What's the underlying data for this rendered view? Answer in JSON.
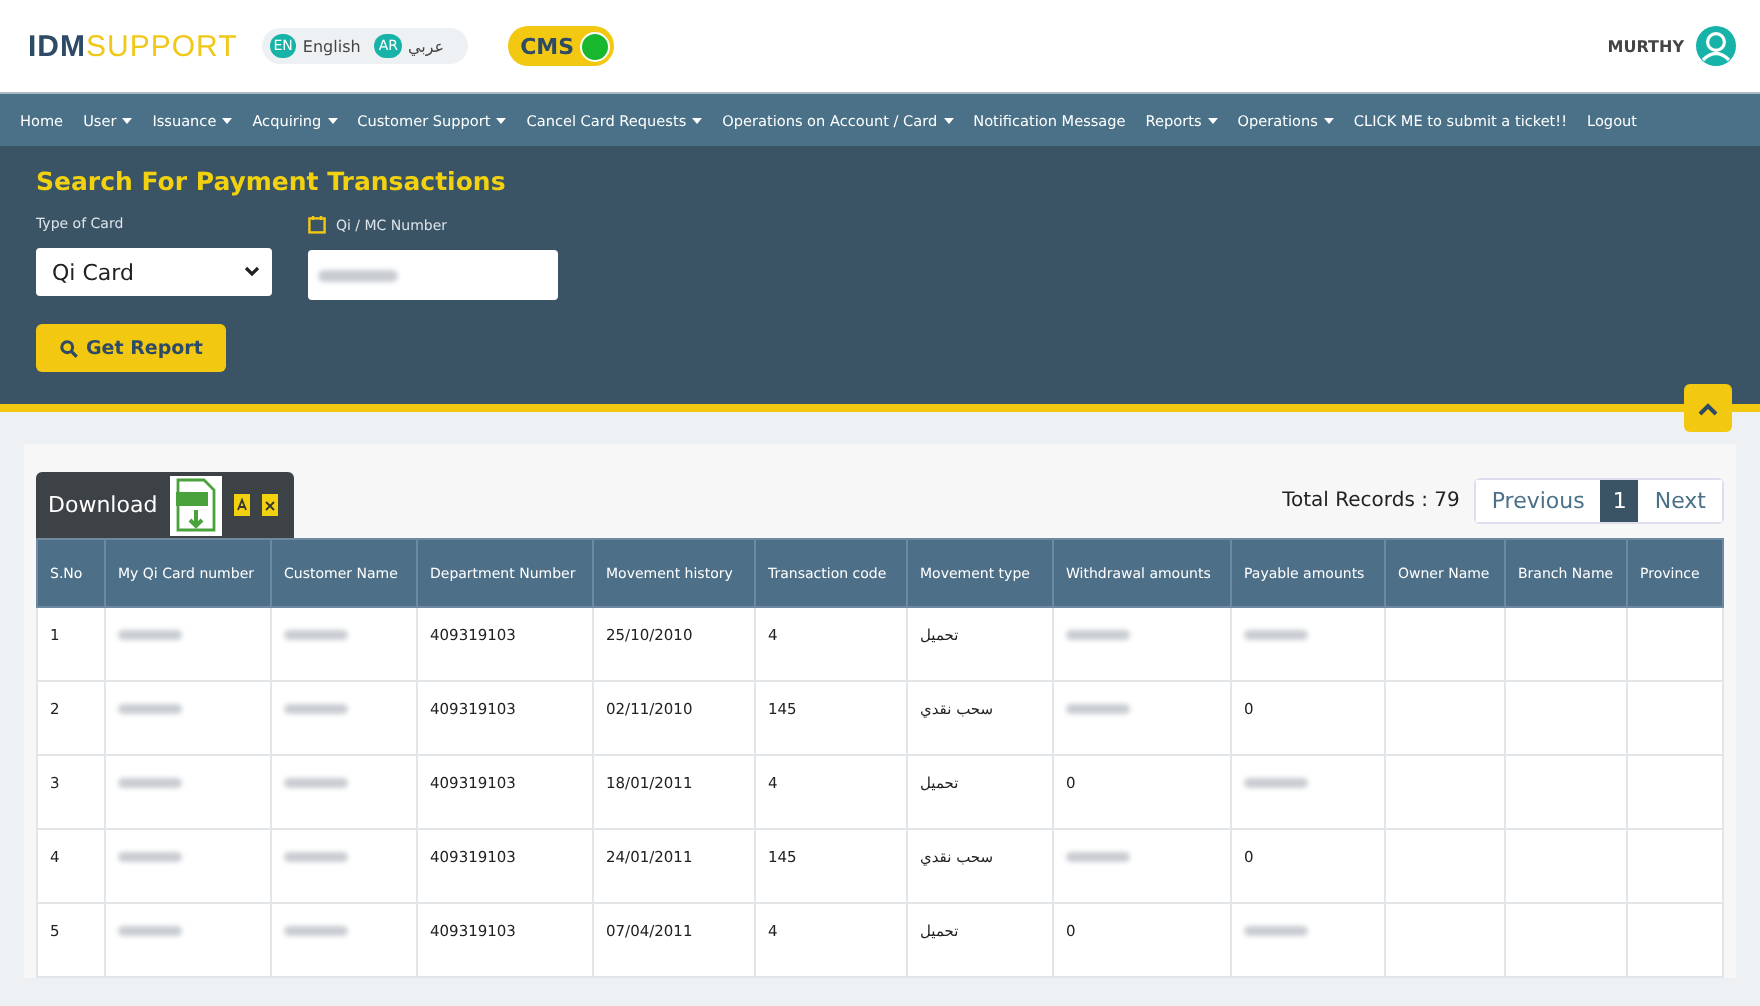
{
  "header": {
    "logo_primary": "IDM",
    "logo_secondary": "SUPPORT",
    "languages": [
      {
        "code": "EN",
        "label": "English"
      },
      {
        "code": "AR",
        "label": "عربي"
      }
    ],
    "cms_toggle": {
      "label": "CMS",
      "on": true
    },
    "user": "MURTHY"
  },
  "nav": [
    {
      "label": "Home",
      "dropdown": false
    },
    {
      "label": "User",
      "dropdown": true
    },
    {
      "label": "Issuance",
      "dropdown": true
    },
    {
      "label": "Acquiring",
      "dropdown": true
    },
    {
      "label": "Customer Support",
      "dropdown": true
    },
    {
      "label": "Cancel Card Requests",
      "dropdown": true
    },
    {
      "label": "Operations on Account / Card",
      "dropdown": true
    },
    {
      "label": "Notification Message",
      "dropdown": false
    },
    {
      "label": "Reports",
      "dropdown": true
    },
    {
      "label": "Operations",
      "dropdown": true
    },
    {
      "label": "CLICK ME to submit a ticket!!",
      "dropdown": false
    },
    {
      "label": "Logout",
      "dropdown": false
    }
  ],
  "search": {
    "title": "Search For Payment Transactions",
    "card_type": {
      "label": "Type of Card",
      "value": "Qi Card"
    },
    "number": {
      "label": "Qi / MC Number",
      "redacted": true
    },
    "button": "Get Report"
  },
  "results": {
    "download_label": "Download",
    "total_label": "Total Records : 79",
    "pagination": [
      {
        "label": "Previous",
        "selected": false
      },
      {
        "label": "1",
        "selected": true
      },
      {
        "label": "Next",
        "selected": false
      }
    ],
    "columns": [
      "S.No",
      "My Qi Card number",
      "Customer Name",
      "Department Number",
      "Movement history",
      "Transaction code",
      "Movement type",
      "Withdrawal amounts",
      "Payable amounts",
      "Owner Name",
      "Branch Name",
      "Province"
    ],
    "rows": [
      {
        "cells": [
          {
            "text": "1"
          },
          {
            "redacted": true
          },
          {
            "redacted": true
          },
          {
            "text": "409319103"
          },
          {
            "text": "25/10/2010"
          },
          {
            "text": "4"
          },
          {
            "text": "تحميل"
          },
          {
            "redacted": true
          },
          {
            "redacted": true
          },
          {},
          {},
          {}
        ]
      },
      {
        "cells": [
          {
            "text": "2"
          },
          {
            "redacted": true
          },
          {
            "redacted": true
          },
          {
            "text": "409319103"
          },
          {
            "text": "02/11/2010"
          },
          {
            "text": "145"
          },
          {
            "text": "سحب نقدي"
          },
          {
            "redacted": true
          },
          {
            "text": "0"
          },
          {},
          {},
          {}
        ]
      },
      {
        "cells": [
          {
            "text": "3"
          },
          {
            "redacted": true
          },
          {
            "redacted": true
          },
          {
            "text": "409319103"
          },
          {
            "text": "18/01/2011"
          },
          {
            "text": "4"
          },
          {
            "text": "تحميل"
          },
          {
            "text": "0"
          },
          {
            "redacted": true
          },
          {},
          {},
          {}
        ]
      },
      {
        "cells": [
          {
            "text": "4"
          },
          {
            "redacted": true
          },
          {
            "redacted": true
          },
          {
            "text": "409319103"
          },
          {
            "text": "24/01/2011"
          },
          {
            "text": "145"
          },
          {
            "text": "سحب نقدي"
          },
          {
            "redacted": true
          },
          {
            "text": "0"
          },
          {},
          {},
          {}
        ]
      },
      {
        "cells": [
          {
            "text": "5"
          },
          {
            "redacted": true
          },
          {
            "redacted": true
          },
          {
            "text": "409319103"
          },
          {
            "text": "07/04/2011"
          },
          {
            "text": "4"
          },
          {
            "text": "تحميل"
          },
          {
            "text": "0"
          },
          {
            "redacted": true
          },
          {},
          {},
          {}
        ]
      }
    ]
  }
}
